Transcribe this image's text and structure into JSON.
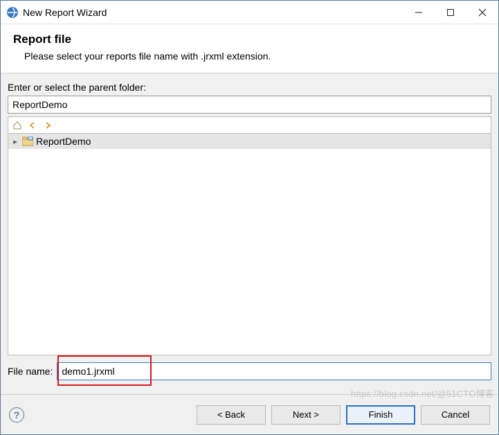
{
  "window": {
    "title": "New Report Wizard"
  },
  "header": {
    "heading": "Report file",
    "description": "Please select your reports file name with .jrxml extension."
  },
  "body": {
    "parent_label": "Enter or select the parent folder:",
    "parent_value": "ReportDemo",
    "tree": {
      "root_label": "ReportDemo"
    },
    "file_label": "File name:",
    "file_value": "demo1.jrxml"
  },
  "buttons": {
    "back": "< Back",
    "next": "Next >",
    "finish": "Finish",
    "cancel": "Cancel"
  },
  "watermark": "https://blog.csdn.net/@51CTO博客"
}
